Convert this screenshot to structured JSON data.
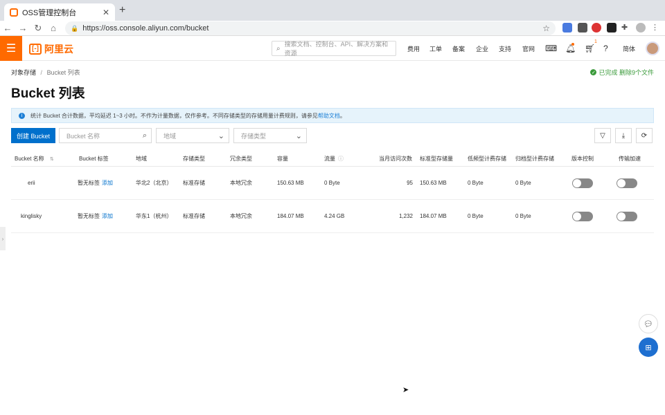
{
  "browser": {
    "tab_title": "OSS管理控制台",
    "url": "https://oss.console.aliyun.com/bucket"
  },
  "header": {
    "logo": "阿里云",
    "search_placeholder": "搜索文档、控制台、API、解决方案和资源",
    "nav": [
      "费用",
      "工单",
      "备案",
      "企业",
      "支持",
      "官网"
    ],
    "lang": "简体",
    "cart_count": "1"
  },
  "breadcrumb": {
    "root": "对象存储",
    "sep": "/",
    "current": "Bucket 列表"
  },
  "status": {
    "text": "已完成 删除9个文件",
    "color": "#3a9a3a"
  },
  "page_title": "Bucket 列表",
  "notice": {
    "text": "统计 Bucket 合计数据，平均延迟 1~3 小时。不作为计量数据，仅作参考。不同存储类型的存储用量计费规则，请参见",
    "link": "帮助文档",
    "end": "。"
  },
  "toolbar": {
    "create_label": "创建 Bucket",
    "name_placeholder": "Bucket 名称",
    "region_placeholder": "地域",
    "storage_placeholder": "存储类型"
  },
  "table": {
    "columns": [
      "Bucket 名称",
      "Bucket 标签",
      "地域",
      "存储类型",
      "冗余类型",
      "容量",
      "流量",
      "当月访问次数",
      "标准型存储量",
      "低频型计费存储",
      "归档型计费存储",
      "版本控制",
      "传输加速"
    ],
    "rows": [
      {
        "name": "erii",
        "tag": "暂无标签",
        "tag_action": "添加",
        "region": "华北2（北京）",
        "storage": "标准存储",
        "redundancy": "本地冗余",
        "capacity": "150.63 MB",
        "traffic": "0 Byte",
        "visits": "95",
        "standard": "150.63 MB",
        "ia": "0 Byte",
        "archive": "0 Byte",
        "versioning": false,
        "acceleration": false
      },
      {
        "name": "kinglisky",
        "tag": "暂无标签",
        "tag_action": "添加",
        "region": "华东1（杭州）",
        "storage": "标准存储",
        "redundancy": "本地冗余",
        "capacity": "184.07 MB",
        "traffic": "4.24 GB",
        "visits": "1,232",
        "standard": "184.07 MB",
        "ia": "0 Byte",
        "archive": "0 Byte",
        "versioning": false,
        "acceleration": false
      }
    ]
  },
  "colors": {
    "brand": "#ff6a00",
    "primary": "#0070cc"
  }
}
